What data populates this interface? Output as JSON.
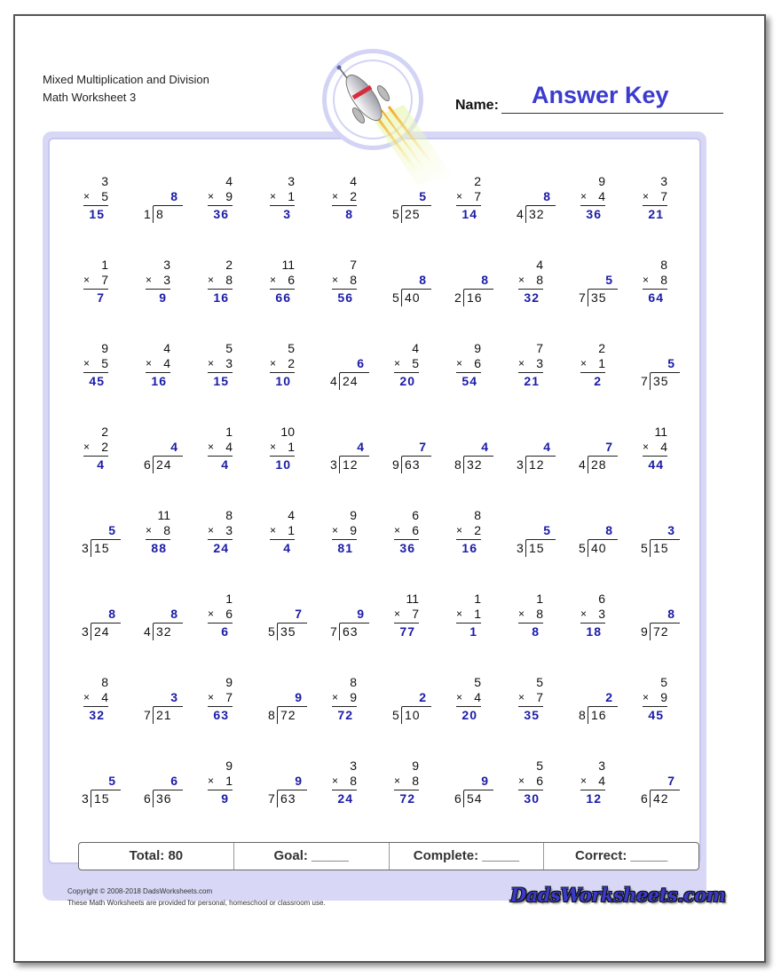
{
  "header": {
    "title_line1": "Mixed Multiplication and Division",
    "title_line2": "Math Worksheet 3",
    "name_label": "Name:",
    "name_value": "Answer Key"
  },
  "colors": {
    "answer": "#1b1ba8",
    "answer_key": "#3b3bd0",
    "frame": "#d8d8f6"
  },
  "problems": [
    [
      {
        "type": "mul",
        "a": "3",
        "b": "5",
        "ans": "15"
      },
      {
        "type": "div",
        "divisor": "1",
        "dividend": "8",
        "ans": "8"
      },
      {
        "type": "mul",
        "a": "4",
        "b": "9",
        "ans": "36"
      },
      {
        "type": "mul",
        "a": "3",
        "b": "1",
        "ans": "3"
      },
      {
        "type": "mul",
        "a": "4",
        "b": "2",
        "ans": "8"
      },
      {
        "type": "div",
        "divisor": "5",
        "dividend": "25",
        "ans": "5"
      },
      {
        "type": "mul",
        "a": "2",
        "b": "7",
        "ans": "14"
      },
      {
        "type": "div",
        "divisor": "4",
        "dividend": "32",
        "ans": "8"
      },
      {
        "type": "mul",
        "a": "9",
        "b": "4",
        "ans": "36"
      },
      {
        "type": "mul",
        "a": "3",
        "b": "7",
        "ans": "21"
      }
    ],
    [
      {
        "type": "mul",
        "a": "1",
        "b": "7",
        "ans": "7"
      },
      {
        "type": "mul",
        "a": "3",
        "b": "3",
        "ans": "9"
      },
      {
        "type": "mul",
        "a": "2",
        "b": "8",
        "ans": "16"
      },
      {
        "type": "mul",
        "a": "11",
        "b": "6",
        "ans": "66"
      },
      {
        "type": "mul",
        "a": "7",
        "b": "8",
        "ans": "56"
      },
      {
        "type": "div",
        "divisor": "5",
        "dividend": "40",
        "ans": "8"
      },
      {
        "type": "div",
        "divisor": "2",
        "dividend": "16",
        "ans": "8"
      },
      {
        "type": "mul",
        "a": "4",
        "b": "8",
        "ans": "32"
      },
      {
        "type": "div",
        "divisor": "7",
        "dividend": "35",
        "ans": "5"
      },
      {
        "type": "mul",
        "a": "8",
        "b": "8",
        "ans": "64"
      }
    ],
    [
      {
        "type": "mul",
        "a": "9",
        "b": "5",
        "ans": "45"
      },
      {
        "type": "mul",
        "a": "4",
        "b": "4",
        "ans": "16"
      },
      {
        "type": "mul",
        "a": "5",
        "b": "3",
        "ans": "15"
      },
      {
        "type": "mul",
        "a": "5",
        "b": "2",
        "ans": "10"
      },
      {
        "type": "div",
        "divisor": "4",
        "dividend": "24",
        "ans": "6"
      },
      {
        "type": "mul",
        "a": "4",
        "b": "5",
        "ans": "20"
      },
      {
        "type": "mul",
        "a": "9",
        "b": "6",
        "ans": "54"
      },
      {
        "type": "mul",
        "a": "7",
        "b": "3",
        "ans": "21"
      },
      {
        "type": "mul",
        "a": "2",
        "b": "1",
        "ans": "2"
      },
      {
        "type": "div",
        "divisor": "7",
        "dividend": "35",
        "ans": "5"
      }
    ],
    [
      {
        "type": "mul",
        "a": "2",
        "b": "2",
        "ans": "4"
      },
      {
        "type": "div",
        "divisor": "6",
        "dividend": "24",
        "ans": "4"
      },
      {
        "type": "mul",
        "a": "1",
        "b": "4",
        "ans": "4"
      },
      {
        "type": "mul",
        "a": "10",
        "b": "1",
        "ans": "10"
      },
      {
        "type": "div",
        "divisor": "3",
        "dividend": "12",
        "ans": "4"
      },
      {
        "type": "div",
        "divisor": "9",
        "dividend": "63",
        "ans": "7"
      },
      {
        "type": "div",
        "divisor": "8",
        "dividend": "32",
        "ans": "4"
      },
      {
        "type": "div",
        "divisor": "3",
        "dividend": "12",
        "ans": "4"
      },
      {
        "type": "div",
        "divisor": "4",
        "dividend": "28",
        "ans": "7"
      },
      {
        "type": "mul",
        "a": "11",
        "b": "4",
        "ans": "44"
      }
    ],
    [
      {
        "type": "div",
        "divisor": "3",
        "dividend": "15",
        "ans": "5"
      },
      {
        "type": "mul",
        "a": "11",
        "b": "8",
        "ans": "88"
      },
      {
        "type": "mul",
        "a": "8",
        "b": "3",
        "ans": "24"
      },
      {
        "type": "mul",
        "a": "4",
        "b": "1",
        "ans": "4"
      },
      {
        "type": "mul",
        "a": "9",
        "b": "9",
        "ans": "81"
      },
      {
        "type": "mul",
        "a": "6",
        "b": "6",
        "ans": "36"
      },
      {
        "type": "mul",
        "a": "8",
        "b": "2",
        "ans": "16"
      },
      {
        "type": "div",
        "divisor": "3",
        "dividend": "15",
        "ans": "5"
      },
      {
        "type": "div",
        "divisor": "5",
        "dividend": "40",
        "ans": "8"
      },
      {
        "type": "div",
        "divisor": "5",
        "dividend": "15",
        "ans": "3"
      }
    ],
    [
      {
        "type": "div",
        "divisor": "3",
        "dividend": "24",
        "ans": "8"
      },
      {
        "type": "div",
        "divisor": "4",
        "dividend": "32",
        "ans": "8"
      },
      {
        "type": "mul",
        "a": "1",
        "b": "6",
        "ans": "6"
      },
      {
        "type": "div",
        "divisor": "5",
        "dividend": "35",
        "ans": "7"
      },
      {
        "type": "div",
        "divisor": "7",
        "dividend": "63",
        "ans": "9"
      },
      {
        "type": "mul",
        "a": "11",
        "b": "7",
        "ans": "77"
      },
      {
        "type": "mul",
        "a": "1",
        "b": "1",
        "ans": "1"
      },
      {
        "type": "mul",
        "a": "1",
        "b": "8",
        "ans": "8"
      },
      {
        "type": "mul",
        "a": "6",
        "b": "3",
        "ans": "18"
      },
      {
        "type": "div",
        "divisor": "9",
        "dividend": "72",
        "ans": "8"
      }
    ],
    [
      {
        "type": "mul",
        "a": "8",
        "b": "4",
        "ans": "32"
      },
      {
        "type": "div",
        "divisor": "7",
        "dividend": "21",
        "ans": "3"
      },
      {
        "type": "mul",
        "a": "9",
        "b": "7",
        "ans": "63"
      },
      {
        "type": "div",
        "divisor": "8",
        "dividend": "72",
        "ans": "9"
      },
      {
        "type": "mul",
        "a": "8",
        "b": "9",
        "ans": "72"
      },
      {
        "type": "div",
        "divisor": "5",
        "dividend": "10",
        "ans": "2"
      },
      {
        "type": "mul",
        "a": "5",
        "b": "4",
        "ans": "20"
      },
      {
        "type": "mul",
        "a": "5",
        "b": "7",
        "ans": "35"
      },
      {
        "type": "div",
        "divisor": "8",
        "dividend": "16",
        "ans": "2"
      },
      {
        "type": "mul",
        "a": "5",
        "b": "9",
        "ans": "45"
      }
    ],
    [
      {
        "type": "div",
        "divisor": "3",
        "dividend": "15",
        "ans": "5"
      },
      {
        "type": "div",
        "divisor": "6",
        "dividend": "36",
        "ans": "6"
      },
      {
        "type": "mul",
        "a": "9",
        "b": "1",
        "ans": "9"
      },
      {
        "type": "div",
        "divisor": "7",
        "dividend": "63",
        "ans": "9"
      },
      {
        "type": "mul",
        "a": "3",
        "b": "8",
        "ans": "24"
      },
      {
        "type": "mul",
        "a": "9",
        "b": "8",
        "ans": "72"
      },
      {
        "type": "div",
        "divisor": "6",
        "dividend": "54",
        "ans": "9"
      },
      {
        "type": "mul",
        "a": "5",
        "b": "6",
        "ans": "30"
      },
      {
        "type": "mul",
        "a": "3",
        "b": "4",
        "ans": "12"
      },
      {
        "type": "div",
        "divisor": "6",
        "dividend": "42",
        "ans": "7"
      }
    ]
  ],
  "summary": {
    "total": "Total: 80",
    "goal": "Goal: _____",
    "complete": "Complete: _____",
    "correct": "Correct: _____"
  },
  "footer": {
    "copyright": "Copyright © 2008-2018 DadsWorksheets.com",
    "usage": "These Math Worksheets are provided for personal, homeschool or classroom use.",
    "logo": "DadsWorksheets.com"
  },
  "icons": {
    "rocket": "rocket-icon"
  }
}
